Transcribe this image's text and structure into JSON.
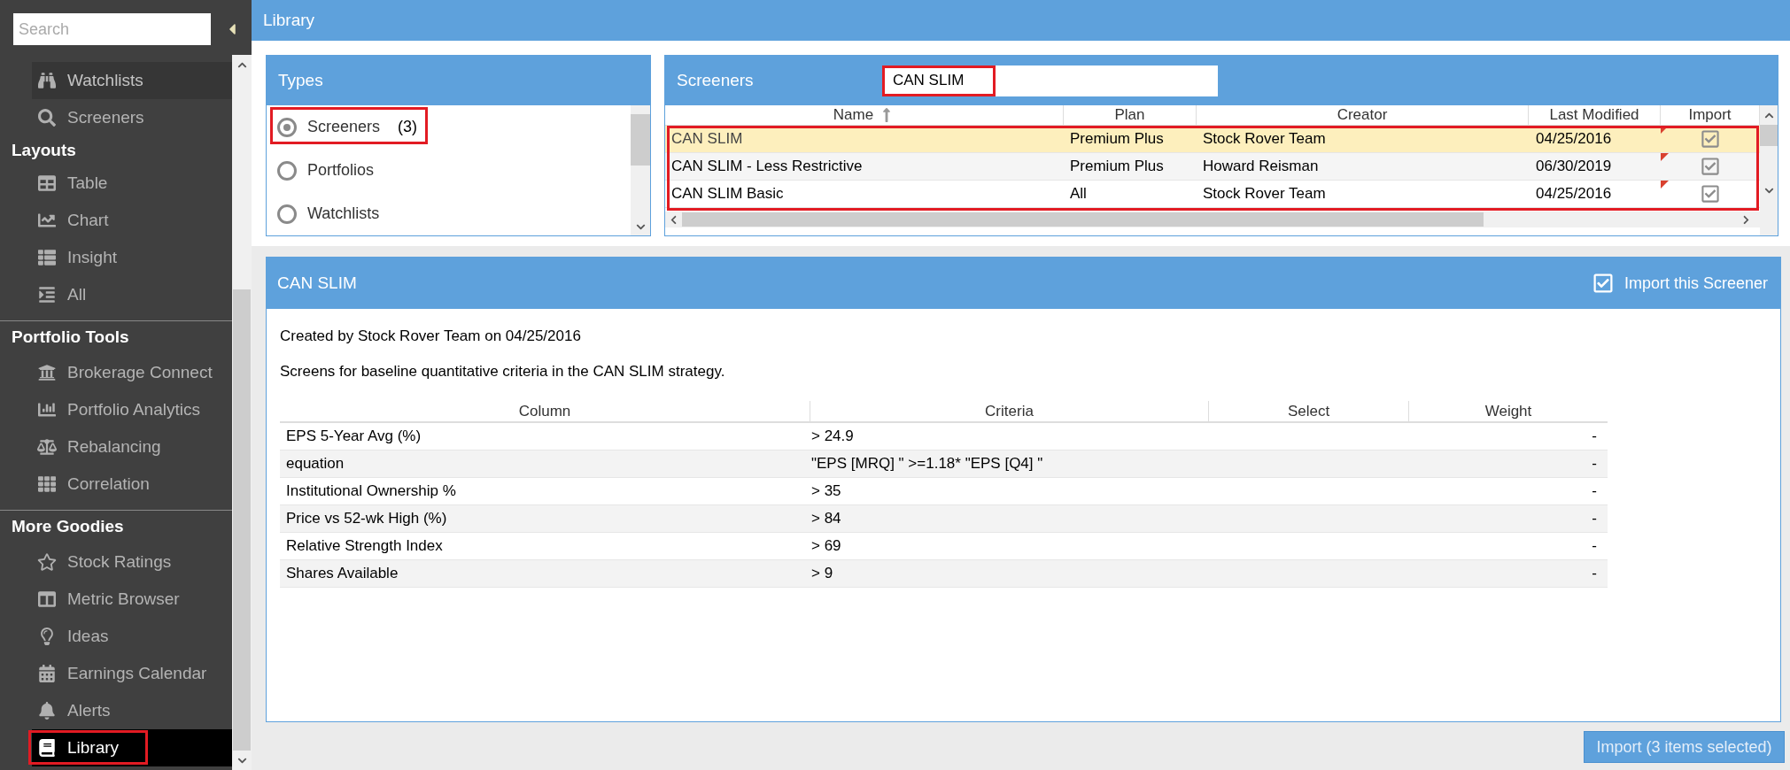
{
  "header": {
    "title": "Library"
  },
  "sidebar": {
    "search": {
      "placeholder": "Search"
    },
    "sections": [
      {
        "items": [
          {
            "label": "Watchlists",
            "selected": false,
            "hovered": true,
            "highlighted": false
          },
          {
            "label": "Screeners",
            "selected": false,
            "hovered": false,
            "highlighted": false
          }
        ]
      },
      {
        "title": "Layouts",
        "items": [
          {
            "label": "Table",
            "selected": false,
            "hovered": false,
            "highlighted": false
          },
          {
            "label": "Chart",
            "selected": false,
            "hovered": false,
            "highlighted": false
          },
          {
            "label": "Insight",
            "selected": false,
            "hovered": false,
            "highlighted": false
          },
          {
            "label": "All",
            "selected": false,
            "hovered": false,
            "highlighted": false
          }
        ]
      },
      {
        "title": "Portfolio Tools",
        "items": [
          {
            "label": "Brokerage Connect",
            "selected": false,
            "hovered": false,
            "highlighted": false
          },
          {
            "label": "Portfolio Analytics",
            "selected": false,
            "hovered": false,
            "highlighted": false
          },
          {
            "label": "Rebalancing",
            "selected": false,
            "hovered": false,
            "highlighted": false
          },
          {
            "label": "Correlation",
            "selected": false,
            "hovered": false,
            "highlighted": false
          }
        ]
      },
      {
        "title": "More Goodies",
        "items": [
          {
            "label": "Stock Ratings",
            "selected": false,
            "hovered": false,
            "highlighted": false
          },
          {
            "label": "Metric Browser",
            "selected": false,
            "hovered": false,
            "highlighted": false
          },
          {
            "label": "Ideas",
            "selected": false,
            "hovered": false,
            "highlighted": false
          },
          {
            "label": "Earnings Calendar",
            "selected": false,
            "hovered": false,
            "highlighted": false
          },
          {
            "label": "Alerts",
            "selected": false,
            "hovered": false,
            "highlighted": false
          },
          {
            "label": "Library",
            "selected": true,
            "hovered": false,
            "highlighted": true
          }
        ]
      }
    ]
  },
  "types": {
    "title": "Types",
    "items": [
      {
        "label": "Screeners",
        "count": "(3)",
        "selected": true,
        "highlighted": true
      },
      {
        "label": "Portfolios",
        "selected": false,
        "highlighted": false
      },
      {
        "label": "Watchlists",
        "selected": false,
        "highlighted": false
      }
    ]
  },
  "screeners": {
    "title": "Screeners",
    "search": {
      "value": "CAN SLIM",
      "highlighted": true
    },
    "columns": [
      {
        "label": "Name",
        "sorted": true
      },
      {
        "label": "Plan"
      },
      {
        "label": "Creator"
      },
      {
        "label": "Last Modified"
      },
      {
        "label": "Import"
      }
    ],
    "rows_highlighted": true,
    "rows": [
      {
        "name": "CAN SLIM",
        "plan": "Premium Plus",
        "creator": "Stock Rover Team",
        "last_modified": "04/25/2016",
        "modified": true,
        "import": true,
        "selected": true
      },
      {
        "name": "CAN SLIM - Less Restrictive",
        "plan": "Premium Plus",
        "creator": "Howard Reisman",
        "last_modified": "06/30/2019",
        "modified": true,
        "import": true,
        "selected": false
      },
      {
        "name": "CAN SLIM Basic",
        "plan": "All",
        "creator": "Stock Rover Team",
        "last_modified": "04/25/2016",
        "modified": true,
        "import": true,
        "selected": false
      }
    ]
  },
  "detail": {
    "title": "CAN SLIM",
    "import": {
      "label": "Import this Screener",
      "checked": true
    },
    "created": "Created by Stock Rover Team on 04/25/2016",
    "description": "Screens for baseline quantitative criteria in the CAN SLIM strategy.",
    "columns": [
      "Column",
      "Criteria",
      "Select",
      "Weight"
    ],
    "rows": [
      {
        "column": "EPS 5-Year Avg (%)",
        "criteria": "> 24.9",
        "weight": "-"
      },
      {
        "column": "equation",
        "criteria": "\"EPS [MRQ] \" >=1.18* \"EPS [Q4] \"",
        "weight": "-"
      },
      {
        "column": "Institutional Ownership %",
        "criteria": "> 35",
        "weight": "-"
      },
      {
        "column": "Price vs 52-wk High (%)",
        "criteria": "> 84",
        "weight": "-"
      },
      {
        "column": "Relative Strength Index",
        "criteria": "> 69",
        "weight": "-"
      },
      {
        "column": "Shares Available",
        "criteria": "> 9",
        "weight": "-"
      }
    ]
  },
  "import_button": {
    "label": "Import (3 items selected)"
  }
}
